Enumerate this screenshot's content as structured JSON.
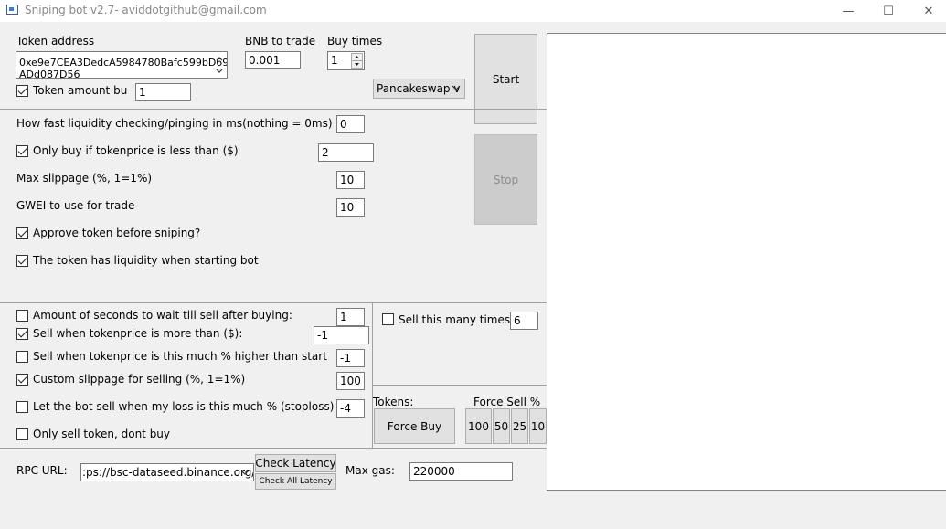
{
  "window": {
    "title": "Sniping bot v2.7- aviddotgithub@gmail.com",
    "minimize_glyph": "—",
    "maximize_glyph": "☐",
    "close_glyph": "✕"
  },
  "token": {
    "label": "Token address",
    "address_line1": "0xe9e7CEA3DedcA5984780Bafc599bD69",
    "address_line2": "ADd087D56",
    "amount_checkbox_label": "Token amount bu",
    "amount_checked": true,
    "amount_value": "1"
  },
  "bnb": {
    "label": "BNB to trade",
    "value": "0.001"
  },
  "buy_times": {
    "label": "Buy times",
    "value": "1"
  },
  "dex": {
    "selected": "Pancakeswap v"
  },
  "actions": {
    "start": "Start",
    "stop": "Stop"
  },
  "buy_settings": {
    "liquidity_label": "How fast liquidity checking/pinging in ms(nothing = 0ms)",
    "liquidity_value": "0",
    "only_buy_label": "Only buy if tokenprice is less than ($)",
    "only_buy_checked": true,
    "only_buy_value": "2",
    "max_slippage_label": "Max slippage (%, 1=1%)",
    "max_slippage_value": "10",
    "gwei_label": "GWEI to use for trade",
    "gwei_value": "10",
    "approve_label": "Approve token before sniping?",
    "approve_checked": true,
    "liquidity_start_label": "The token has liquidity when starting bot",
    "liquidity_start_checked": true
  },
  "sell_settings": {
    "wait_label": "Amount of seconds to wait till sell after buying:",
    "wait_checked": false,
    "wait_value": "1",
    "sell_more_label": "Sell when tokenprice is more than ($):",
    "sell_more_checked": true,
    "sell_more_value": "-1",
    "sell_pct_label": "Sell when tokenprice is this much % higher than start",
    "sell_pct_checked": false,
    "sell_pct_value": "-1",
    "custom_slip_label": "Custom slippage for selling (%, 1=1%)",
    "custom_slip_checked": true,
    "custom_slip_value": "100",
    "stoploss_label": "Let the bot sell when my loss is this much % (stoploss)",
    "stoploss_checked": false,
    "stoploss_value": "-4",
    "only_sell_label": "Only sell token, dont buy",
    "only_sell_checked": false,
    "sell_times_label": "Sell this many times:",
    "sell_times_checked": false,
    "sell_times_value": "6"
  },
  "tokens_panel": {
    "tokens_label": "Tokens:",
    "force_buy": "Force Buy",
    "force_sell_label": "Force Sell %",
    "sell_pcts": [
      "100",
      "50",
      "25",
      "10"
    ]
  },
  "rpc": {
    "label": "RPC URL:",
    "value": ":ps://bsc-dataseed.binance.org/",
    "check_latency": "Check Latency",
    "check_all_latency": "Check All Latency",
    "max_gas_label": "Max gas:",
    "max_gas_value": "220000"
  }
}
